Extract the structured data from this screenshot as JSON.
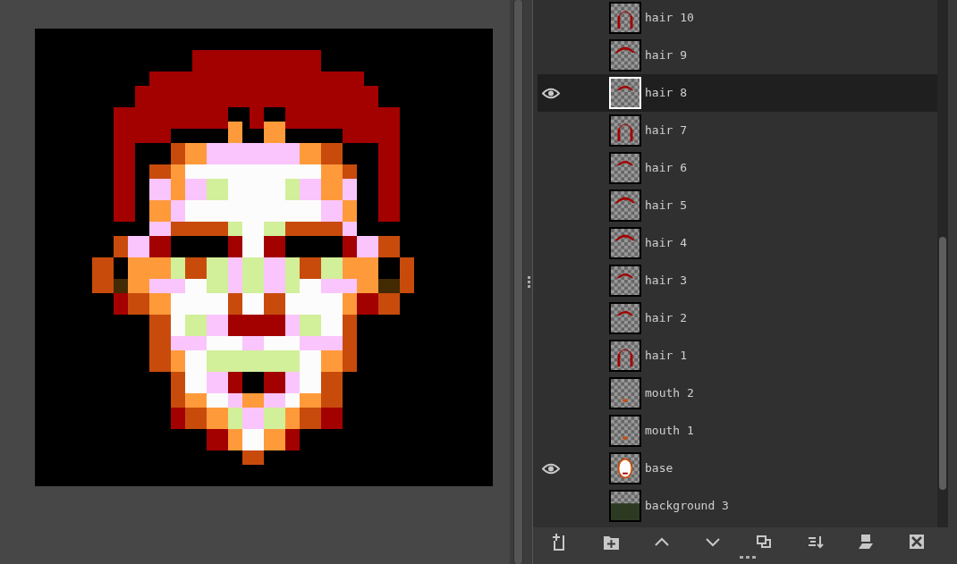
{
  "layers": [
    {
      "name": "hair 10",
      "kind": "hair-long",
      "visible": false,
      "selected": false
    },
    {
      "name": "hair 9",
      "kind": "hair-top",
      "visible": false,
      "selected": false
    },
    {
      "name": "hair 8",
      "kind": "hair-cap",
      "visible": true,
      "selected": true
    },
    {
      "name": "hair 7",
      "kind": "hair-long",
      "visible": false,
      "selected": false
    },
    {
      "name": "hair 6",
      "kind": "hair-cap",
      "visible": false,
      "selected": false
    },
    {
      "name": "hair 5",
      "kind": "hair-top",
      "visible": false,
      "selected": false
    },
    {
      "name": "hair 4",
      "kind": "hair-top",
      "visible": false,
      "selected": false
    },
    {
      "name": "hair 3",
      "kind": "hair-cap",
      "visible": false,
      "selected": false
    },
    {
      "name": "hair 2",
      "kind": "hair-cap",
      "visible": false,
      "selected": false
    },
    {
      "name": "hair 1",
      "kind": "hair-long",
      "visible": false,
      "selected": false
    },
    {
      "name": "mouth 2",
      "kind": "mouth",
      "visible": false,
      "selected": false
    },
    {
      "name": "mouth 1",
      "kind": "mouth",
      "visible": false,
      "selected": false
    },
    {
      "name": "base",
      "kind": "face",
      "visible": true,
      "selected": false
    },
    {
      "name": "background 3",
      "kind": "background",
      "visible": false,
      "selected": false
    }
  ]
}
